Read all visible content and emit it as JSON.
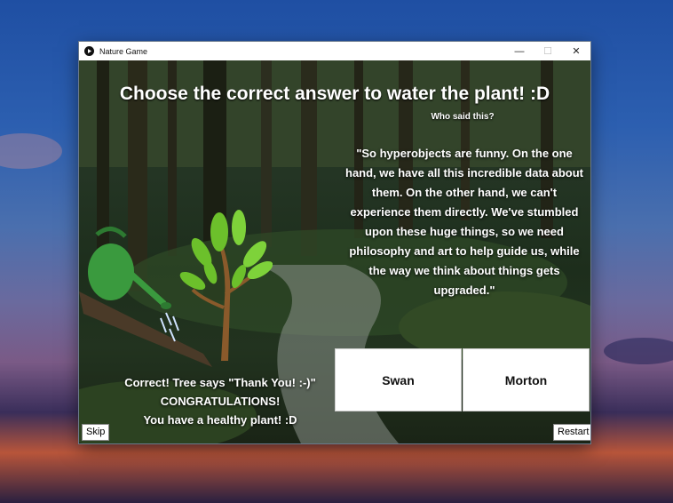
{
  "window": {
    "title": "Nature Game",
    "minimize": "—",
    "maximize": "☐",
    "close": "✕"
  },
  "heading": "Choose the correct answer to water the plant! :D",
  "prompt": "Who said this?",
  "quote": "\"So hyperobjects are funny. On the one hand, we have all this incredible data about them. On the other hand, we can't experience them directly. We've stumbled upon these huge things, so we need philosophy and art to help guide us, while the way we think about things gets upgraded.\"",
  "answers": [
    "Swan",
    "Morton"
  ],
  "feedback": {
    "line1": "Correct! Tree says \"Thank You! :-)\"",
    "line2": "CONGRATULATIONS!",
    "line3": "You have a healthy plant! :D"
  },
  "buttons": {
    "skip": "Skip",
    "restart": "Restart"
  },
  "icons": {
    "app": "app-icon",
    "tree": "tree-icon",
    "can": "watering-can-icon"
  },
  "colors": {
    "leaf": "#6cc02b",
    "can": "#3a9a3e"
  }
}
